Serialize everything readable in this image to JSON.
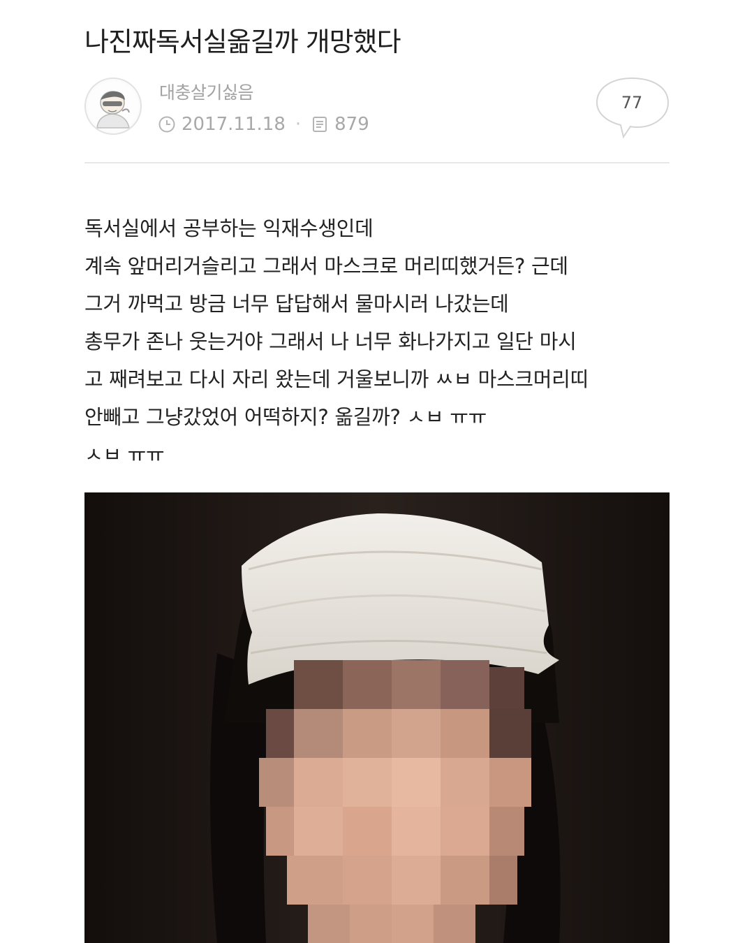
{
  "post": {
    "title": "나진짜독서실옮길까 개망했다",
    "author": "대충살기싫음",
    "date": "2017.11.18",
    "views": "879",
    "comments": "77",
    "body_lines": [
      "독서실에서 공부하는 익재수생인데",
      "계속 앞머리거슬리고 그래서 마스크로 머리띠했거든? 근데",
      "그거 까먹고 방금 너무 답답해서 물마시러 나갔는데",
      "총무가 존나 웃는거야 그래서 나 너무 화나가지고 일단 마시",
      "고 째려보고 다시 자리 왔는데 거울보니까 ㅆㅂ 마스크머리띠",
      "안빼고 그냥갔었어 어떡하지? 옮길까? ㅅㅂ ㅠㅠ",
      "ㅅㅂ ㅠㅠ"
    ]
  },
  "icons": {
    "avatar": "profile-avatar-icon",
    "date": "clock-icon",
    "views": "document-icon",
    "comments": "speech-bubble-icon"
  },
  "colors": {
    "text": "#222222",
    "meta": "#a8a8a8",
    "divider": "#e7e7e7",
    "photo_background": "#1b1513",
    "mask": "#eae6df"
  }
}
